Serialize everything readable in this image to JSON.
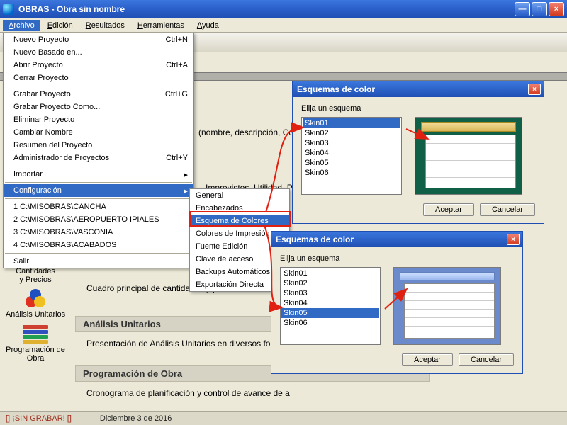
{
  "titlebar": {
    "title": "OBRAS - Obra sin nombre"
  },
  "menubar": {
    "items": [
      {
        "label": "Archivo",
        "ul": "A",
        "rest": "rchivo",
        "active": true
      },
      {
        "label": "Edición",
        "ul": "E",
        "rest": "dición"
      },
      {
        "label": "Resultados",
        "ul": "R",
        "rest": "esultados"
      },
      {
        "label": "Herramientas",
        "ul": "H",
        "rest": "erramientas"
      },
      {
        "label": "Ayuda",
        "ul": "A",
        "rest": "yuda"
      }
    ]
  },
  "dropdown": {
    "items": [
      {
        "label": "Nuevo Proyecto",
        "shortcut": "Ctrl+N"
      },
      {
        "label": "Nuevo Basado en..."
      },
      {
        "label": "Abrir Proyecto",
        "shortcut": "Ctrl+A"
      },
      {
        "label": "Cerrar Proyecto"
      },
      {
        "sep": true
      },
      {
        "label": "Grabar Proyecto",
        "shortcut": "Ctrl+G"
      },
      {
        "label": "Grabar Proyecto Como..."
      },
      {
        "label": "Eliminar Proyecto"
      },
      {
        "label": "Cambiar Nombre"
      },
      {
        "label": "Resumen del Proyecto"
      },
      {
        "label": "Administrador de Proyectos",
        "shortcut": "Ctrl+Y"
      },
      {
        "sep": true
      },
      {
        "label": "Importar",
        "arrow": true
      },
      {
        "sep": true
      },
      {
        "label": "Configuración",
        "arrow": true,
        "highlight": true
      },
      {
        "sep": true
      },
      {
        "label": "1 C:\\MISOBRAS\\CANCHA"
      },
      {
        "label": "2 C:\\MISOBRAS\\AEROPUERTO IPIALES"
      },
      {
        "label": "3 C:\\MISOBRAS\\VASCONIA"
      },
      {
        "label": "4 C:\\MISOBRAS\\ACABADOS"
      },
      {
        "sep": true
      },
      {
        "label": "Salir"
      }
    ]
  },
  "submenu": {
    "items": [
      {
        "label": "General"
      },
      {
        "label": "Encabezados"
      },
      {
        "label": "Esquema de Colores",
        "highlight": true
      },
      {
        "label": "Colores de Impresión"
      },
      {
        "label": "Fuente Edición"
      },
      {
        "label": "Clave de acceso"
      },
      {
        "label": "Backups Automáticos"
      },
      {
        "label": "Exportación Directa"
      }
    ]
  },
  "bg_texts": {
    "line1": "(nombre, descripción, Contra",
    "line2": "...Imprevistos, Utilidad, Póliza",
    "cantidades": "Cantidades",
    "precios": "y Precios",
    "body1": "Cuadro principal de cantidades y precios unitarios del",
    "hdr2": "Análisis Unitarios",
    "body2": "Presentación de Análisis Unitarios en diversos formato",
    "hdr3": "Programación de Obra",
    "body3": "Cronograma de planificación y control de avance de a",
    "side2": "Análisis Unitarios",
    "side3": "Programación de Obra"
  },
  "dialog": {
    "title": "Esquemas de color",
    "prompt": "Elija un esquema",
    "options": [
      "Skin01",
      "Skin02",
      "Skin03",
      "Skin04",
      "Skin05",
      "Skin06"
    ],
    "accept": "Aceptar",
    "cancel": "Cancelar"
  },
  "dlg1_selected": "Skin01",
  "dlg2_selected": "Skin05",
  "statusbar": {
    "warn": "[] ¡SIN GRABAR! []",
    "date": "Diciembre 3 de 2016"
  }
}
